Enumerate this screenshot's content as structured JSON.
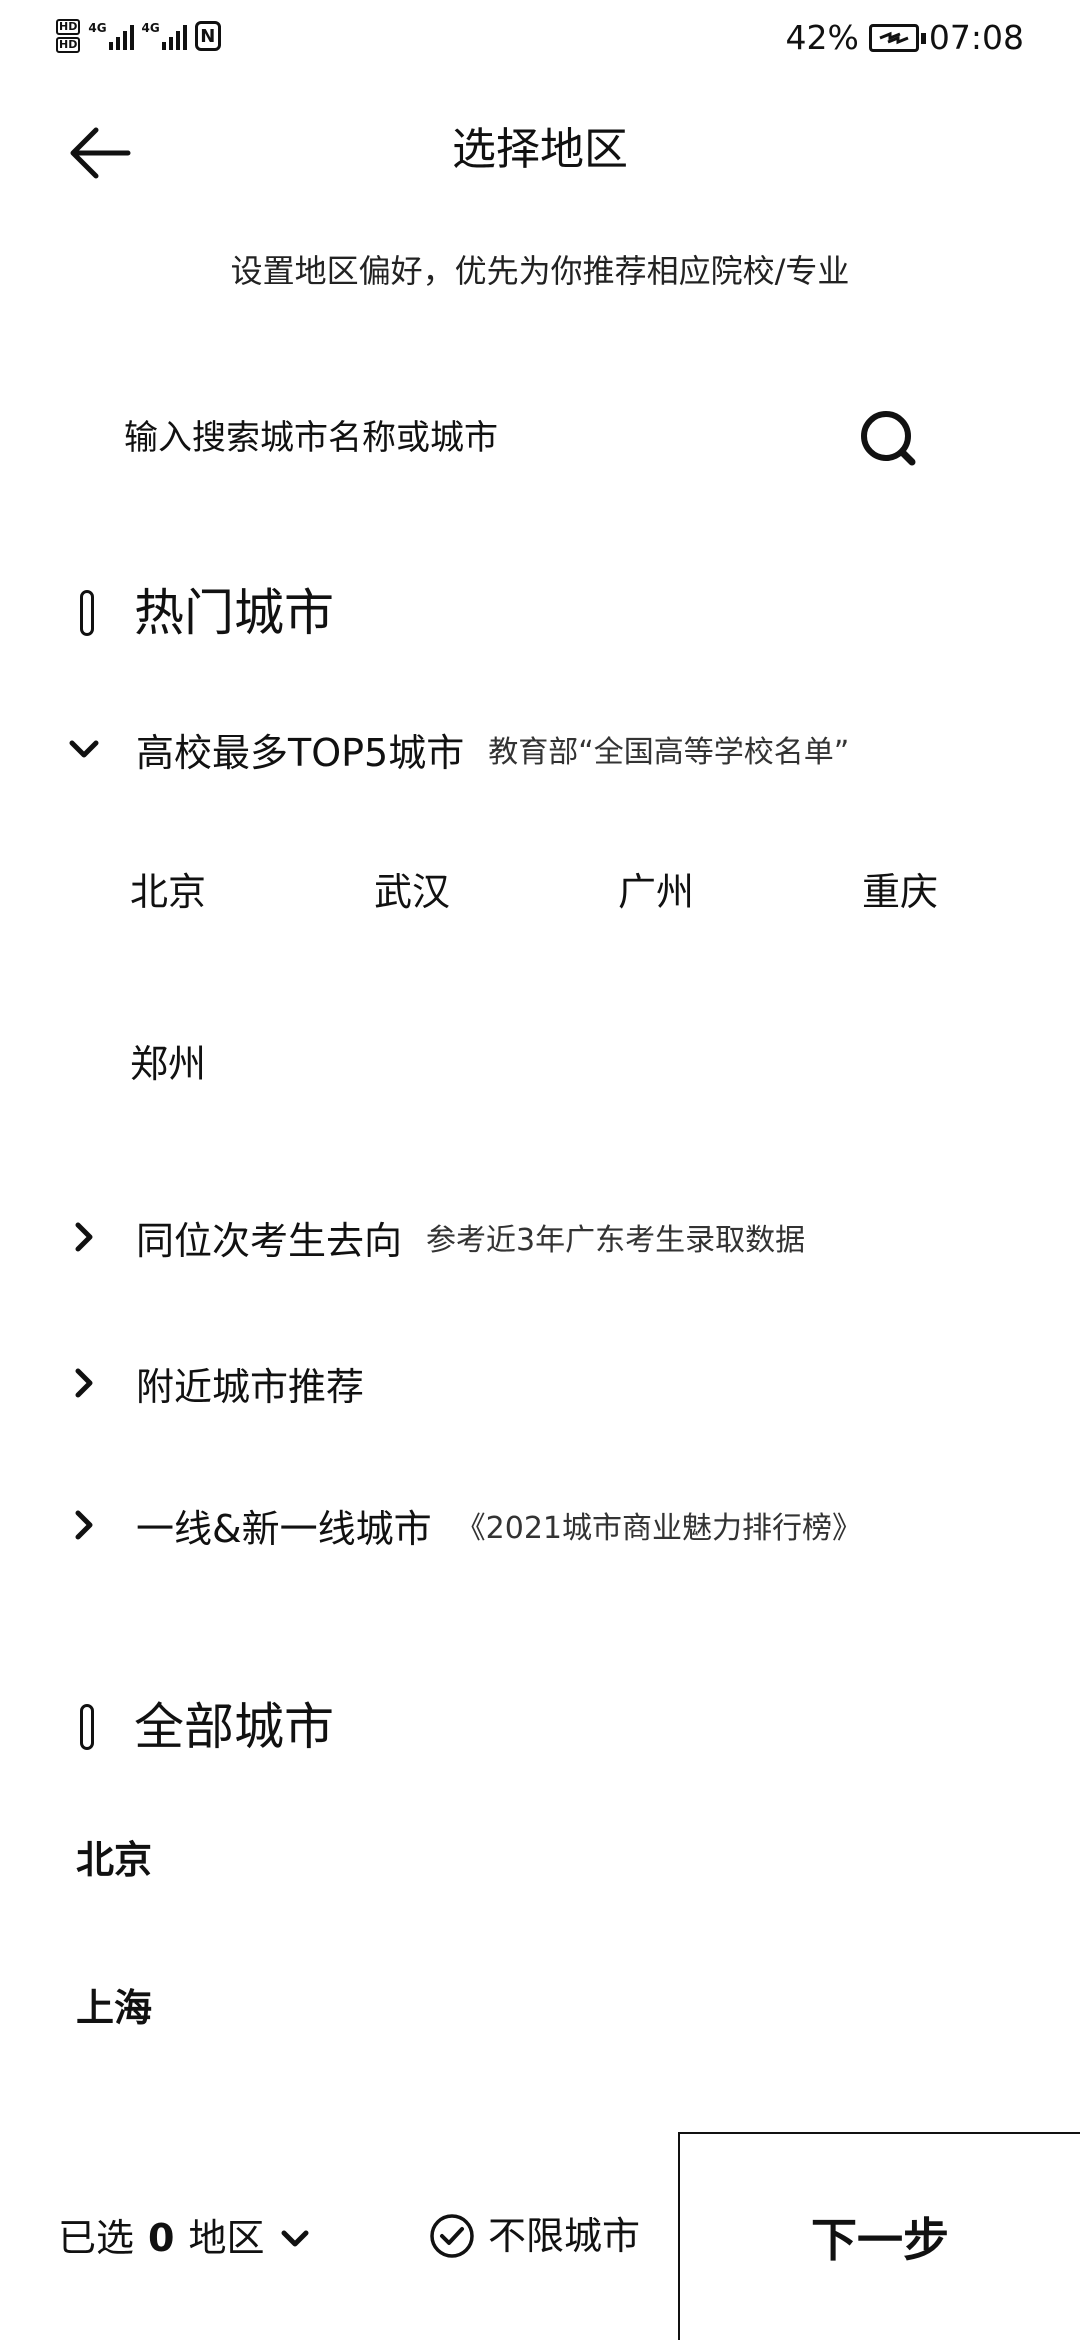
{
  "status_bar": {
    "hd_badge": "HD",
    "network_1": "4G",
    "network_2": "4G",
    "nfc_label": "N",
    "battery_percent": "42%",
    "time": "07:08"
  },
  "header": {
    "title": "选择地区",
    "back_icon": "arrow-left-icon"
  },
  "subtitle": "设置地区偏好，优先为你推荐相应院校/专业",
  "search": {
    "placeholder": "输入搜索城市名称或城市",
    "icon": "search-icon"
  },
  "hot_cities": {
    "title": "热门城市",
    "groups": [
      {
        "title": "高校最多TOP5城市",
        "note": "教育部“全国高等学校名单”",
        "expanded": true,
        "cities": [
          "北京",
          "武汉",
          "广州",
          "重庆",
          "郑州"
        ]
      },
      {
        "title": "同位次考生去向",
        "note": "参考近3年广东考生录取数据",
        "expanded": false
      },
      {
        "title": "附近城市推荐",
        "note": "",
        "expanded": false
      },
      {
        "title": "一线&新一线城市",
        "note": "《2021城市商业魅力排行榜》",
        "expanded": false
      }
    ]
  },
  "all_cities": {
    "title": "全部城市",
    "items": [
      "北京",
      "上海"
    ]
  },
  "bottom_bar": {
    "selected_prefix": "已选",
    "selected_count": "0",
    "selected_suffix": "地区",
    "unlimited_label": "不限城市",
    "next_label": "下一步"
  }
}
